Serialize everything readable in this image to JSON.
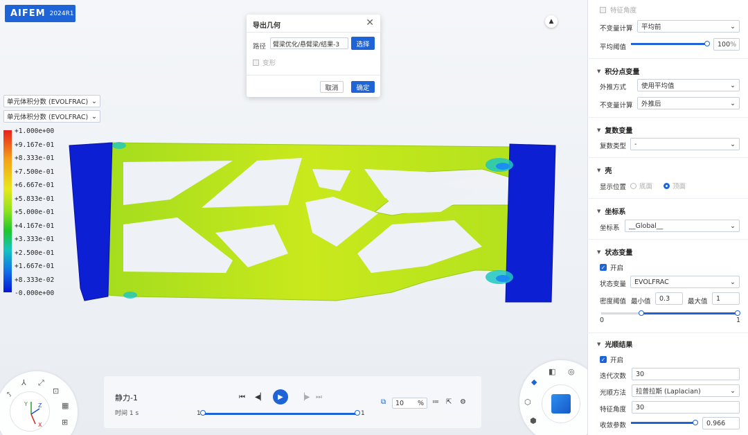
{
  "app": {
    "brand": "AIFEM",
    "version": "2024R1"
  },
  "viewport": {
    "variable_select_1": "单元体积分数 (EVOLFRAC)",
    "variable_select_2": "单元体积分数 (EVOLFRAC)",
    "legend": [
      "+1.000e+00",
      "+9.167e-01",
      "+8.333e-01",
      "+7.500e-01",
      "+6.667e-01",
      "+5.833e-01",
      "+5.000e-01",
      "+4.167e-01",
      "+3.333e-01",
      "+2.500e-01",
      "+1.667e-01",
      "+8.333e-02",
      "-0.000e+00"
    ],
    "axes": {
      "y": "Y",
      "z": "Z",
      "x": "X"
    }
  },
  "dialog": {
    "title": "导出几何",
    "path_label": "路径",
    "path_value": "臂梁优化/悬臂梁/结果-3",
    "choose_label": "选择",
    "deform_label": "变形",
    "cancel_label": "取消",
    "ok_label": "确定"
  },
  "playback": {
    "step_name": "静力-1",
    "time_label": "时间 1 s",
    "start": "1",
    "end": "1",
    "speed_value": "10",
    "speed_unit": "%"
  },
  "panel": {
    "feature_angle_top": "特征角度",
    "invariant_calc_1": {
      "label": "不变量计算",
      "value": "平均前"
    },
    "avg_threshold": {
      "label": "平均阈值",
      "value": "100",
      "unit": "%",
      "fill": 1.0
    },
    "integration": {
      "section": "积分点变量",
      "extrapolation": {
        "label": "外推方式",
        "value": "使用平均值"
      },
      "invariant": {
        "label": "不变量计算",
        "value": "外推后"
      }
    },
    "complex": {
      "section": "复数变量",
      "type": {
        "label": "复数类型",
        "value": "-"
      }
    },
    "shell": {
      "section": "壳",
      "position_label": "显示位置",
      "bottom": "底面",
      "top": "顶面"
    },
    "coord": {
      "section": "坐标系",
      "label": "坐标系",
      "value": "__Global__"
    },
    "state": {
      "section": "状态变量",
      "enable": "开启",
      "var_label": "状态变量",
      "var_value": "EVOLFRAC",
      "density_label": "密度阈值",
      "min_label": "最小值",
      "min_value": "0.3",
      "max_label": "最大值",
      "max_value": "1",
      "range_min": "0",
      "range_max": "1",
      "slider_low": 0.3,
      "slider_high": 1.0
    },
    "smooth": {
      "section": "光顺结果",
      "enable": "开启",
      "iter_label": "迭代次数",
      "iter_value": "30",
      "method_label": "光顺方法",
      "method_value": "拉普拉斯 (Laplacian)",
      "angle_label": "特征角度",
      "angle_value": "30",
      "conv_label": "收敛参数",
      "conv_value": "0.966",
      "conv_fill": 0.966
    }
  },
  "colors": {
    "accent": "#1f64d6",
    "mesh_green": "#c6e81c",
    "support_blue": "#0d1fd2"
  }
}
